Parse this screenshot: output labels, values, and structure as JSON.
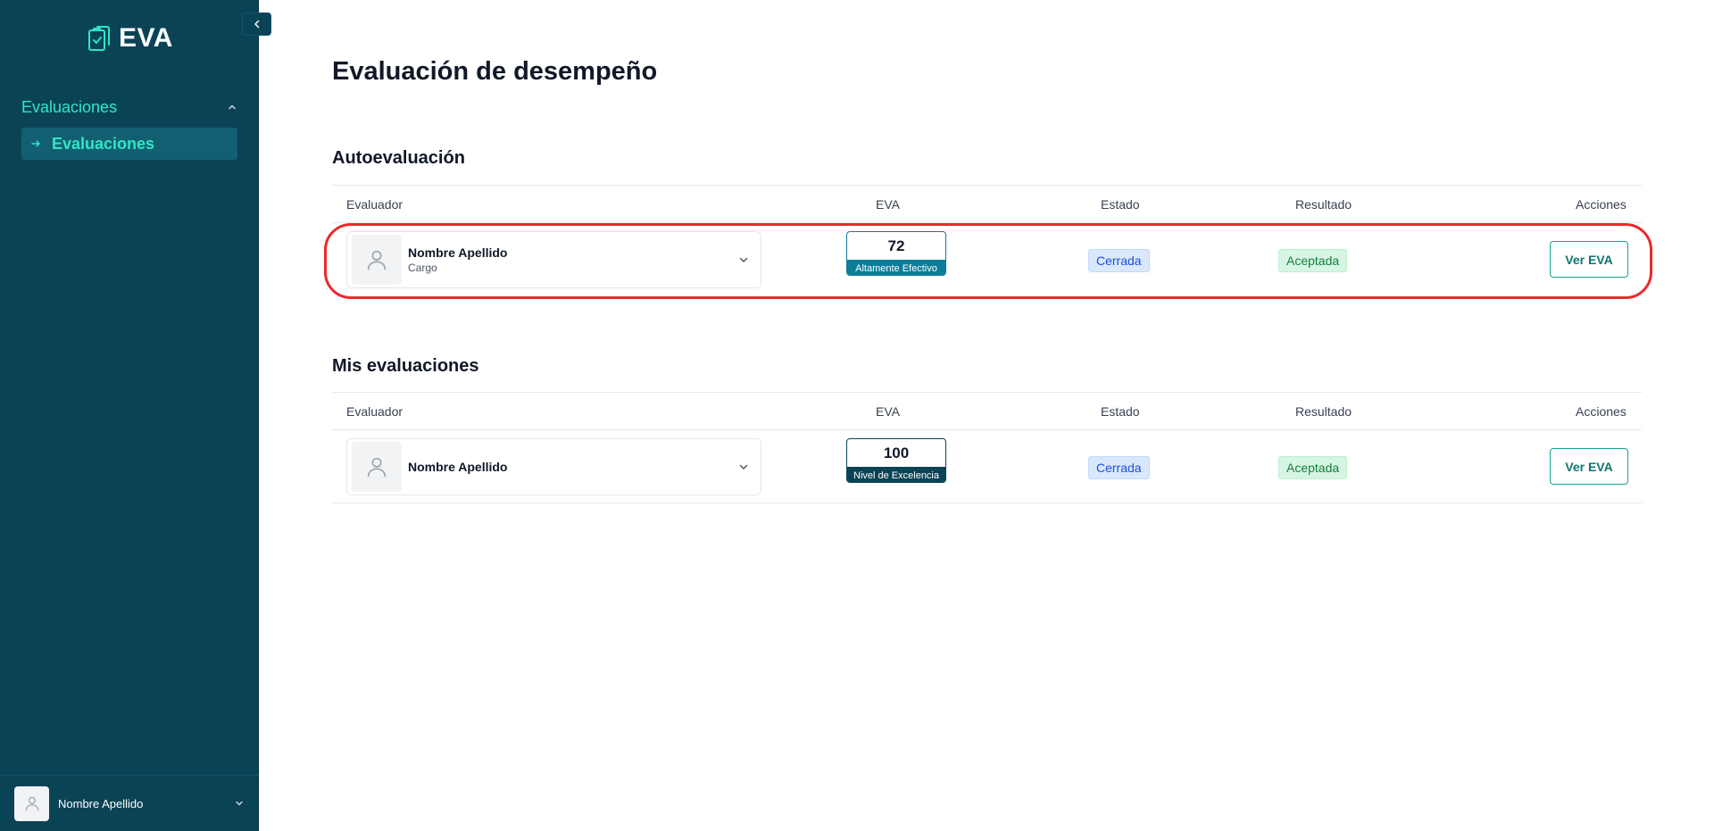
{
  "app": {
    "name": "EVA"
  },
  "sidebar": {
    "group_label": "Evaluaciones",
    "items": [
      {
        "label": "Evaluaciones"
      }
    ],
    "user": {
      "name": "Nombre Apellido"
    }
  },
  "page": {
    "title": "Evaluación de desempeño"
  },
  "columns": {
    "evaluator": "Evaluador",
    "eva": "EVA",
    "status": "Estado",
    "result": "Resultado",
    "actions": "Acciones"
  },
  "self_evaluation": {
    "title": "Autoevaluación",
    "rows": [
      {
        "name": "Nombre Apellido",
        "role": "Cargo",
        "score": "72",
        "level": "Altamente Efectivo",
        "status": "Cerrada",
        "result": "Aceptada",
        "action": "Ver EVA"
      }
    ]
  },
  "my_evaluations": {
    "title": "Mis evaluaciones",
    "rows": [
      {
        "name": "Nombre Apellido",
        "score": "100",
        "level": "Nivel de Excelencia",
        "status": "Cerrada",
        "result": "Aceptada",
        "action": "Ver EVA"
      }
    ]
  },
  "colors": {
    "sidebar_bg": "#0b4356",
    "accent": "#2ee6c9",
    "score_effective": "#0c7d9a",
    "score_excellence": "#0b4356",
    "highlight": "#ea2a2a"
  },
  "icons": {
    "brand": "clipboard-check-icon",
    "collapse": "chevron-left-icon",
    "group_toggle": "chevron-up-icon",
    "nav_item": "arrow-right-icon",
    "avatar": "user-icon",
    "dropdown": "chevron-down-icon"
  }
}
